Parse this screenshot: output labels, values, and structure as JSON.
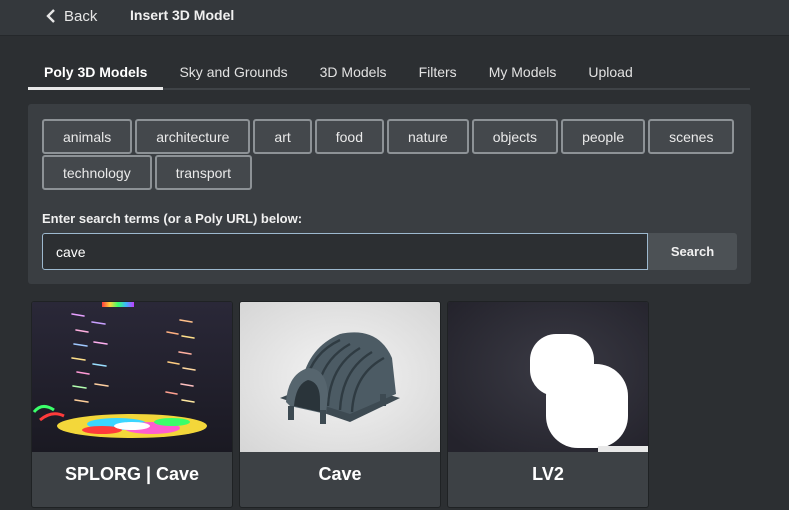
{
  "header": {
    "back_label": "Back",
    "title": "Insert 3D Model"
  },
  "tabs": [
    {
      "label": "Poly 3D Models",
      "active": true
    },
    {
      "label": "Sky and Grounds"
    },
    {
      "label": "3D Models"
    },
    {
      "label": "Filters"
    },
    {
      "label": "My Models"
    },
    {
      "label": "Upload"
    }
  ],
  "categories": [
    "animals",
    "architecture",
    "art",
    "food",
    "nature",
    "objects",
    "people",
    "scenes",
    "technology",
    "transport"
  ],
  "search": {
    "label": "Enter search terms (or a Poly URL) below:",
    "value": "cave",
    "button_label": "Search"
  },
  "results": [
    {
      "title": "SPLORG | Cave",
      "thumb": "colorful-particles"
    },
    {
      "title": "Cave",
      "thumb": "tunnel-model"
    },
    {
      "title": "LV2",
      "thumb": "white-blobs"
    }
  ],
  "colors": {
    "background": "#2c2f32",
    "panel": "#3a3e42",
    "accent_border": "#9db9cf"
  }
}
